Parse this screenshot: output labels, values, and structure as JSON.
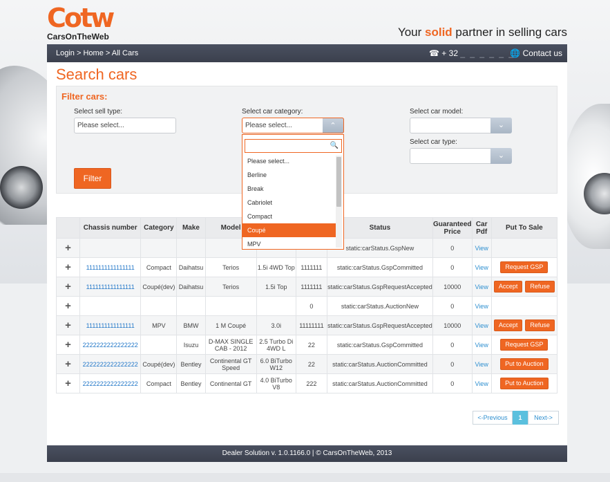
{
  "brand": {
    "logo_mark": "Cotw",
    "logo_text": "CarsOnTheWeb",
    "tagline_pre": "Your ",
    "tagline_hl": "solid",
    "tagline_post": " partner in selling cars",
    "accent_color": "#ef6622"
  },
  "topbar": {
    "breadcrumb": [
      "Login",
      "Home",
      "All Cars"
    ],
    "phone": "+ 32",
    "phone_masked": "_ _ _ _ _ _",
    "phone_icon": "phone-icon",
    "contact": "Contact us",
    "contact_icon": "globe-icon"
  },
  "page_title": "Search cars",
  "filter": {
    "title": "Filter cars:",
    "sell_type": {
      "label": "Select sell type:",
      "placeholder": "Please select..."
    },
    "category": {
      "label": "Select car category:",
      "value": "Please select..."
    },
    "model": {
      "label": "Select car model:",
      "value": ""
    },
    "car_type": {
      "label": "Select car type:",
      "value": ""
    },
    "button": "Filter"
  },
  "dropdown": {
    "search_value": "",
    "search_icon": "search-icon",
    "items": [
      "Please select...",
      "Berline",
      "Break",
      "Cabriolet",
      "Compact",
      "Coupé",
      "MPV"
    ],
    "selected": "Coupé"
  },
  "table": {
    "headers": [
      "",
      "Chassis number",
      "Category",
      "Make",
      "Model",
      "",
      "",
      "Status",
      "Guaranteed Price",
      "Car Pdf",
      "Put To Sale"
    ],
    "rows": [
      {
        "chassis": "",
        "category": "",
        "make": "",
        "model": "",
        "engine": "",
        "km": "",
        "status": "static:carStatus.GspNew",
        "price": "0",
        "pdf": "View",
        "actions": []
      },
      {
        "chassis": "1111111111111111",
        "category": "Compact",
        "make": "Daihatsu",
        "model": "Terios",
        "engine": "1.5i 4WD Top",
        "km": "1111111",
        "status": "static:carStatus.GspCommitted",
        "price": "0",
        "pdf": "View",
        "actions": [
          "Request GSP"
        ]
      },
      {
        "chassis": "1111111111111111",
        "category": "Coupé(dev)",
        "make": "Daihatsu",
        "model": "Terios",
        "engine": "1.5i Top",
        "km": "1111111",
        "status": "static:carStatus.GspRequestAccepted",
        "price": "10000",
        "pdf": "View",
        "actions": [
          "Accept",
          "Refuse"
        ]
      },
      {
        "chassis": "",
        "category": "",
        "make": "",
        "model": "",
        "engine": "",
        "km": "0",
        "status": "static:carStatus.AuctionNew",
        "price": "0",
        "pdf": "View",
        "actions": []
      },
      {
        "chassis": "1111111111111111",
        "category": "MPV",
        "make": "BMW",
        "model": "1 M Coupé",
        "engine": "3.0i",
        "km": "11111111",
        "status": "static:carStatus.GspRequestAccepted",
        "price": "10000",
        "pdf": "View",
        "actions": [
          "Accept",
          "Refuse"
        ]
      },
      {
        "chassis": "2222222222222222",
        "category": "",
        "make": "Isuzu",
        "model": "D-MAX SINGLE CAB - 2012",
        "engine": "2.5 Turbo Di 4WD L",
        "km": "22",
        "status": "static:carStatus.GspCommitted",
        "price": "0",
        "pdf": "View",
        "actions": [
          "Request GSP"
        ]
      },
      {
        "chassis": "2222222222222222",
        "category": "Coupé(dev)",
        "make": "Bentley",
        "model": "Continental GT Speed",
        "engine": "6.0 BiTurbo W12",
        "km": "22",
        "status": "static:carStatus.AuctionCommitted",
        "price": "0",
        "pdf": "View",
        "actions": [
          "Put to Auction"
        ]
      },
      {
        "chassis": "2222222222222222",
        "category": "Compact",
        "make": "Bentley",
        "model": "Continental GT",
        "engine": "4.0 BiTurbo V8",
        "km": "222",
        "status": "static:carStatus.AuctionCommitted",
        "price": "0",
        "pdf": "View",
        "actions": [
          "Put to Auction"
        ]
      }
    ],
    "expand_icon": "plus-icon"
  },
  "pager": {
    "prev": "<-Previous",
    "current": "1",
    "next": "Next->"
  },
  "footer": "Dealer Solution v. 1.0.1166.0 | © CarsOnTheWeb, 2013"
}
